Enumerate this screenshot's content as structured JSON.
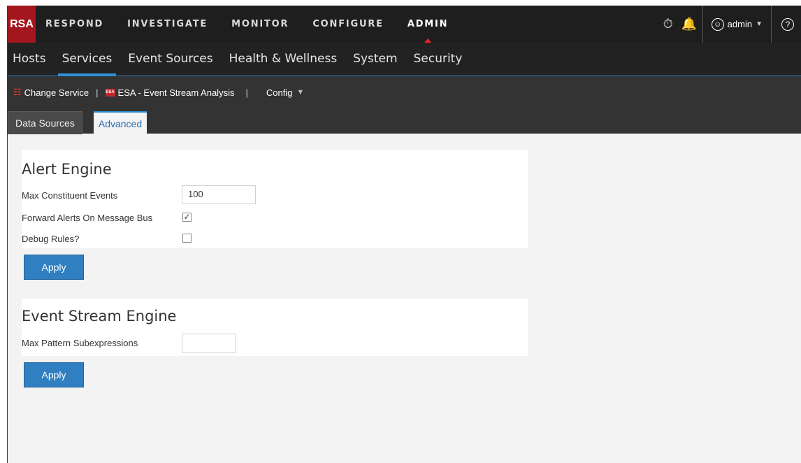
{
  "topnav": {
    "logo": "RSA",
    "items": [
      "RESPOND",
      "INVESTIGATE",
      "MONITOR",
      "CONFIGURE",
      "ADMIN"
    ],
    "active": "ADMIN",
    "user": "admin",
    "help": "?"
  },
  "subnav": {
    "tabs": [
      "Hosts",
      "Services",
      "Event Sources",
      "Health & Wellness",
      "System",
      "Security"
    ],
    "active": "Services"
  },
  "toolbar": {
    "change_service": "Change Service",
    "divider": "|",
    "esa_badge": "ESA",
    "service_name": "ESA - Event Stream Analysis",
    "view": "Config"
  },
  "viewtabs": {
    "tabs": [
      "Data Sources",
      "Advanced"
    ],
    "active": "Advanced"
  },
  "alert_engine": {
    "title": "Alert Engine",
    "max_constituent_label": "Max Constituent Events",
    "max_constituent_value": "100",
    "forward_alerts_label": "Forward Alerts On Message Bus",
    "forward_alerts_checked": true,
    "debug_rules_label": "Debug Rules?",
    "debug_rules_checked": false,
    "apply_label": "Apply"
  },
  "event_stream_engine": {
    "title": "Event Stream Engine",
    "max_pattern_label": "Max Pattern Subexpressions",
    "max_pattern_value": "",
    "apply_label": "Apply"
  },
  "colors": {
    "accent": "#2f7fc1",
    "brand": "#a3161d",
    "nav_bg": "#1e1e1e",
    "toolbar_bg": "#333333"
  }
}
